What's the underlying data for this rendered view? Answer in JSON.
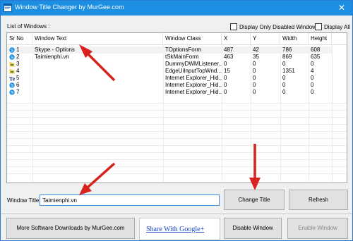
{
  "window": {
    "title": "Window Title Changer by MurGee.com",
    "close_glyph": "✕",
    "app_icon": "app-icon"
  },
  "list_label": "List of Windows :",
  "checkbox_disabled_only": "Display Only Disabled Windows",
  "checkbox_display_all": "Display All",
  "columns": [
    "Sr No",
    "Window Text",
    "Window Class",
    "X",
    "Y",
    "Width",
    "Height"
  ],
  "rows": [
    {
      "icon": "skype-icon",
      "sr": "1",
      "text": "Skype‪‪ - Options",
      "class": "TOptionsForm",
      "x": "487",
      "y": "42",
      "width": "786",
      "height": "608"
    },
    {
      "icon": "skype-icon",
      "sr": "2",
      "text": "Taimienphi.vn",
      "class": "tSkMainForm",
      "x": "463",
      "y": "35",
      "width": "869",
      "height": "635"
    },
    {
      "icon": "folder-icon",
      "sr": "3",
      "text": "",
      "class": "DummyDWMListener...",
      "x": "0",
      "y": "0",
      "width": "0",
      "height": "0"
    },
    {
      "icon": "folder-icon",
      "sr": "4",
      "text": "",
      "class": "EdgeUiInputTopWnd...",
      "x": "15",
      "y": "0",
      "width": "1351",
      "height": "4"
    },
    {
      "icon": "te-icon",
      "sr": "5",
      "text": "",
      "class": "Internet Explorer_Hid...",
      "x": "0",
      "y": "0",
      "width": "0",
      "height": "0"
    },
    {
      "icon": "skype-icon",
      "sr": "6",
      "text": "",
      "class": "Internet Explorer_Hid...",
      "x": "0",
      "y": "0",
      "width": "0",
      "height": "0"
    },
    {
      "icon": "skype-icon",
      "sr": "7",
      "text": "",
      "class": "Internet Explorer_Hid...",
      "x": "0",
      "y": "0",
      "width": "0",
      "height": "0"
    }
  ],
  "window_title_label": "Window Title :",
  "window_title_value": "Taimienphi.vn",
  "buttons": {
    "change_title": "Change Title",
    "refresh": "Refresh",
    "more_software": "More Software Downloads by MurGee.com",
    "disable_window": "Disable Window",
    "enable_window": "Enable Window"
  },
  "share_link": "Share With Google+",
  "colors": {
    "titlebar": "#1c8fe3",
    "arrow": "#d9211e",
    "link": "#1a44c8"
  }
}
